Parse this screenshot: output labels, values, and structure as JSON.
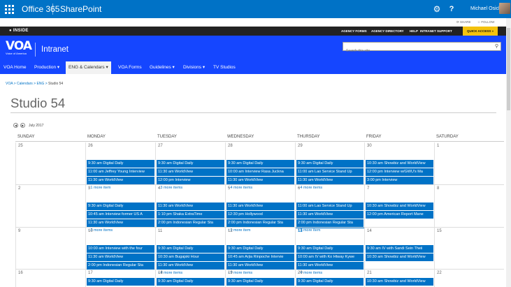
{
  "o365": {
    "app_name": "Office 365",
    "site_name": "SharePoint",
    "user_name": "Michael Osicki",
    "gear_icon": "gear-icon",
    "help_label": "?"
  },
  "actions": {
    "share": "SHARE",
    "follow": "FOLLOW"
  },
  "top_bar": {
    "logo": "INSIDE",
    "links": [
      "AGENCY FORMS",
      "AGENCY DIRECTORY",
      "HELP",
      "INTRANET SUPPORT"
    ],
    "quick_access": "QUICK ACCESS"
  },
  "banner": {
    "logo_text": "VOA",
    "logo_subtext": "Voice of America",
    "title": "Intranet",
    "search_placeholder": "Search this site"
  },
  "nav": {
    "items": [
      {
        "label": "VOA Home"
      },
      {
        "label": "Production"
      },
      {
        "label": "ENG & Calendars"
      },
      {
        "label": "VOA Forms"
      },
      {
        "label": "Guidelines"
      },
      {
        "label": "Divisions"
      },
      {
        "label": "TV Studios"
      }
    ]
  },
  "breadcrumb": [
    "VOA",
    "Calendars",
    "ENG",
    "Studio 54"
  ],
  "page_title": "Studio 54",
  "calendar": {
    "month_label": "July 2017",
    "days": [
      "SUNDAY",
      "MONDAY",
      "TUESDAY",
      "WEDNESDAY",
      "THURSDAY",
      "FRIDAY",
      "SATURDAY"
    ],
    "weeks": [
      {
        "cells": [
          {
            "num": "25",
            "events": [],
            "more": ""
          },
          {
            "num": "26",
            "events": [
              "9:30 am Digital Daily",
              "11:00 am Jeffrey Young Interview",
              "11:30 am WorldView"
            ],
            "more": "- 1 more item"
          },
          {
            "num": "27",
            "events": [
              "9:30 am Digital Daily",
              "11:30 am WorldView",
              "12:00 pm Interview"
            ],
            "more": "- 3 more items"
          },
          {
            "num": "28",
            "events": [
              "9:30 am Digital Daily",
              "10:00 am Interview Rasa Juckna",
              "11:30 am WorldView"
            ],
            "more": "- 4 more items"
          },
          {
            "num": "29",
            "events": [
              "9:30 am Digital Daily",
              "11:00 am Lao Service Stand Up",
              "11:30 am WorldView"
            ],
            "more": "- 4 more items"
          },
          {
            "num": "30",
            "events": [
              "10:30 am Showbiz and WorldView",
              "12:00 pm Interview w/GWU's Ma",
              "3:00 pm Interview"
            ],
            "more": ""
          },
          {
            "num": "1",
            "events": [],
            "more": ""
          }
        ]
      },
      {
        "cells": [
          {
            "num": "2",
            "events": [],
            "more": ""
          },
          {
            "num": "3",
            "events": [
              "9:30 am Digital Daily",
              "10:45 am Interview former US A",
              "11:30 am WorldView"
            ],
            "more": "- 2 more items"
          },
          {
            "num": "4",
            "events": [
              "11:30 am WorldView",
              "1:10 pm Shaka ExtraTime",
              "2:00 pm Indonesian Regular Sta"
            ],
            "more": ""
          },
          {
            "num": "5",
            "events": [
              "11:30 am WorldView",
              "12:30 pm Hollywood",
              "2:00 pm Indonesian Regular Sta"
            ],
            "more": "- 1 more item"
          },
          {
            "num": "6",
            "events": [
              "11:00 am Lao Service Stand Up",
              "11:30 am WorldView",
              "2:00 pm Indonesian Regular Sta"
            ],
            "more": "- 1 more item"
          },
          {
            "num": "7",
            "events": [
              "10:30 am Showbiz and WorldView",
              "12:00 pm American Report Mane"
            ],
            "more": ""
          },
          {
            "num": "8",
            "events": [],
            "more": ""
          }
        ]
      },
      {
        "cells": [
          {
            "num": "9",
            "events": [],
            "more": ""
          },
          {
            "num": "10",
            "events": [
              "10:00 am Interview with the four",
              "11:30 am WorldView",
              "2:00 pm Indonesian Regular Sta"
            ],
            "more": ""
          },
          {
            "num": "11",
            "events": [
              "9:30 am Digital Daily",
              "10:30 am Bugajski Hour",
              "11:30 am WorldView"
            ],
            "more": "- 4 more items"
          },
          {
            "num": "12",
            "events": [
              "9:30 am Digital Daily",
              "10:45 am Arjia Rinpoche Intervie",
              "11:30 am WorldView"
            ],
            "more": "- 3 more items"
          },
          {
            "num": "13",
            "events": [
              "9:30 am Digital Daily",
              "10:00 am IV with Ko Htway Kywe",
              "11:30 am WorldView"
            ],
            "more": "- 4 more items",
            "today": true
          },
          {
            "num": "14",
            "events": [
              "9:30 am IV with Sandi Sein Theii",
              "10:30 am Showbiz and WorldView"
            ],
            "more": ""
          },
          {
            "num": "15",
            "events": [],
            "more": ""
          }
        ]
      },
      {
        "cells": [
          {
            "num": "16",
            "events": [],
            "more": ""
          },
          {
            "num": "17",
            "events": [
              "9:30 am Digital Daily"
            ],
            "more": ""
          },
          {
            "num": "18",
            "events": [
              "9:30 am Digital Daily"
            ],
            "more": ""
          },
          {
            "num": "19",
            "events": [
              "9:30 am Digital Daily"
            ],
            "more": ""
          },
          {
            "num": "20",
            "events": [
              "9:30 am Digital Daily"
            ],
            "more": ""
          },
          {
            "num": "21",
            "events": [
              "10:30 am Showbiz and WorldView"
            ],
            "more": ""
          },
          {
            "num": "22",
            "events": [],
            "more": ""
          }
        ]
      }
    ]
  }
}
